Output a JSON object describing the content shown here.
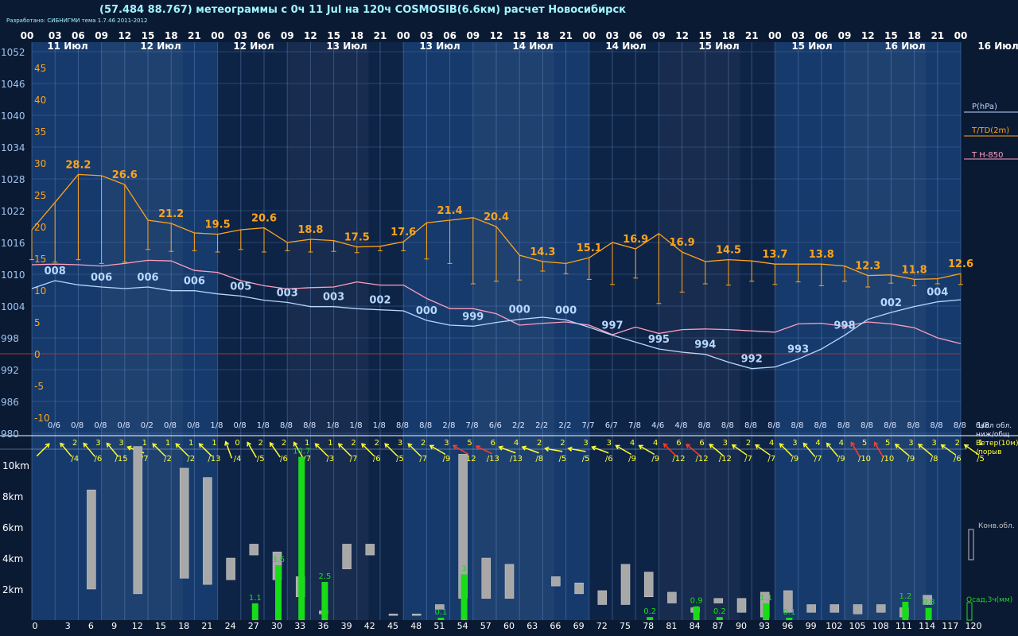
{
  "header": {
    "title": "(57.484 88.767) метеограммы с  0ч 11 Jul на 120ч COSMOSIB(6.6км) расчет Новосибирск",
    "developer": "Разработано: СИБНИГМИ тема 1.7.46 2011-2012"
  },
  "colors": {
    "background": "#0b1a33",
    "band_light": "#163a6b",
    "band_dark": "#0e2447",
    "pressure": "#b8d8ff",
    "temperature": "#ffa41b",
    "t850": "#ff9fc0",
    "zero_line": "#b03030",
    "wind_arrow": "#ffff33",
    "wind_arrow_strong": "#ff3b2b",
    "precip": "#18dc18",
    "cloud": "#a8a8a8",
    "text_time": "#ffffff",
    "pressure_axis": "#9fc4f0"
  },
  "chart_data": {
    "type": "line",
    "time_hours": [
      "00",
      "03",
      "06",
      "09",
      "12",
      "15",
      "18",
      "21",
      "00",
      "03",
      "06",
      "09",
      "12",
      "15",
      "18",
      "21",
      "00",
      "03",
      "06",
      "09",
      "12",
      "15",
      "18",
      "21",
      "00",
      "03",
      "06",
      "09",
      "12",
      "15",
      "18",
      "21",
      "00",
      "03",
      "06",
      "09",
      "12",
      "15",
      "18",
      "21",
      "00"
    ],
    "date_labels": [
      "11 Июл",
      "12 Июл",
      "12 Июл",
      "13 Июл",
      "13 Июл",
      "14 Июл",
      "14 Июл",
      "15 Июл",
      "15 Июл",
      "16 Июл",
      "16 Июл"
    ],
    "forecast_steps": [
      "0",
      "3",
      "6",
      "9",
      "12",
      "15",
      "18",
      "21",
      "24",
      "27",
      "30",
      "33",
      "36",
      "39",
      "42",
      "45",
      "48",
      "51",
      "54",
      "57",
      "60",
      "63",
      "66",
      "69",
      "72",
      "75",
      "78",
      "81",
      "84",
      "87",
      "90",
      "93",
      "96",
      "99",
      "102",
      "105",
      "108",
      "111",
      "114",
      "117",
      "120"
    ],
    "pressure_axis": {
      "label": "P(hPa)",
      "ticks": [
        "1052",
        "1046",
        "1040",
        "1034",
        "1028",
        "1022",
        "1016",
        "1010",
        "1004",
        "998",
        "992",
        "986",
        "980"
      ],
      "range": [
        980,
        1052
      ]
    },
    "temp_axis": {
      "label": "T/TD(2m)",
      "ticks": [
        "45",
        "40",
        "35",
        "30",
        "25",
        "20",
        "15",
        "10",
        "5",
        "0",
        "-5",
        "-10"
      ],
      "range": [
        -10,
        45
      ]
    },
    "t850_label": "T H-850",
    "temperature": [
      19.5,
      23.8,
      28.2,
      28.0,
      26.6,
      21.0,
      20.5,
      19.0,
      18.8,
      19.5,
      19.8,
      17.5,
      18.0,
      17.8,
      16.8,
      16.9,
      17.6,
      20.6,
      21.0,
      21.4,
      20.0,
      15.5,
      14.5,
      14.2,
      15.1,
      17.5,
      16.5,
      18.9,
      16.0,
      14.5,
      14.8,
      14.6,
      14.1,
      14.1,
      14.1,
      13.8,
      12.3,
      12.4,
      11.7,
      11.8,
      12.6
    ],
    "dewpoint": [
      14.8,
      14.4,
      14.8,
      14.2,
      14.4,
      16.4,
      16.1,
      16.2,
      16.0,
      16.4,
      16.0,
      16.2,
      16.0,
      16.1,
      15.9,
      16.2,
      16.2,
      14.9,
      14.2,
      11.0,
      11.4,
      11.6,
      13.0,
      12.6,
      11.7,
      10.9,
      11.9,
      7.9,
      9.7,
      11.0,
      10.8,
      11.4,
      10.9,
      11.3,
      10.7,
      11.4,
      10.5,
      11.1,
      10.7,
      11.0,
      10.9
    ],
    "temperature_labels": [
      {
        "i": 2,
        "v": "28.2"
      },
      {
        "i": 4,
        "v": "26.6"
      },
      {
        "i": 6,
        "v": "21.2"
      },
      {
        "i": 8,
        "v": "19.5"
      },
      {
        "i": 10,
        "v": "20.6"
      },
      {
        "i": 12,
        "v": "18.8"
      },
      {
        "i": 14,
        "v": "17.5"
      },
      {
        "i": 16,
        "v": "17.6"
      },
      {
        "i": 18,
        "v": "21.4"
      },
      {
        "i": 20,
        "v": "20.4"
      },
      {
        "i": 22,
        "v": "14.3"
      },
      {
        "i": 24,
        "v": "15.1"
      },
      {
        "i": 26,
        "v": "16.9"
      },
      {
        "i": 28,
        "v": "16.9"
      },
      {
        "i": 30,
        "v": "14.5"
      },
      {
        "i": 32,
        "v": "13.7"
      },
      {
        "i": 34,
        "v": "13.8"
      },
      {
        "i": 36,
        "v": "12.3"
      },
      {
        "i": 38,
        "v": "11.8"
      },
      {
        "i": 40,
        "v": "12.6"
      }
    ],
    "pressure": [
      1007.3,
      1008.8,
      1008.0,
      1007.6,
      1007.3,
      1007.6,
      1006.9,
      1006.9,
      1006.3,
      1005.9,
      1005.1,
      1004.7,
      1003.9,
      1003.9,
      1003.5,
      1003.3,
      1003.1,
      1001.3,
      1000.4,
      1000.2,
      1000.9,
      1001.5,
      1001.9,
      1001.4,
      1000.0,
      998.5,
      997.2,
      995.9,
      995.3,
      994.9,
      993.4,
      992.2,
      992.5,
      994.0,
      995.9,
      998.5,
      1001.5,
      1002.8,
      1003.9,
      1004.8,
      1005.2
    ],
    "pressure_labels": [
      {
        "i": 1,
        "v": "008"
      },
      {
        "i": 3,
        "v": "006"
      },
      {
        "i": 5,
        "v": "006"
      },
      {
        "i": 7,
        "v": "006"
      },
      {
        "i": 9,
        "v": "005"
      },
      {
        "i": 11,
        "v": "003"
      },
      {
        "i": 13,
        "v": "003"
      },
      {
        "i": 15,
        "v": "002"
      },
      {
        "i": 17,
        "v": "000"
      },
      {
        "i": 19,
        "v": "999"
      },
      {
        "i": 21,
        "v": "000"
      },
      {
        "i": 23,
        "v": "000"
      },
      {
        "i": 25,
        "v": "997"
      },
      {
        "i": 27,
        "v": "995"
      },
      {
        "i": 29,
        "v": "994"
      },
      {
        "i": 31,
        "v": "992"
      },
      {
        "i": 33,
        "v": "993"
      },
      {
        "i": 35,
        "v": "998"
      },
      {
        "i": 37,
        "v": "002"
      },
      {
        "i": 39,
        "v": "004"
      }
    ],
    "t850": [
      14.0,
      14.1,
      14.0,
      13.8,
      14.2,
      14.7,
      14.6,
      13.1,
      12.8,
      11.5,
      10.7,
      10.2,
      10.4,
      10.5,
      11.3,
      10.8,
      10.8,
      8.7,
      7.1,
      7.1,
      6.3,
      4.5,
      4.8,
      5.0,
      4.5,
      3.0,
      4.2,
      3.2,
      3.8,
      3.9,
      3.8,
      3.6,
      3.4,
      4.7,
      4.8,
      4.3,
      5.0,
      4.7,
      4.1,
      2.5,
      1.6
    ],
    "cloud_cover": [
      "0/6",
      "0/8",
      "0/8",
      "0/8",
      "0/2",
      "0/8",
      "0/8",
      "1/8",
      "0/8",
      "1/8",
      "8/8",
      "8/8",
      "1/8",
      "1/8",
      "1/8",
      "8/8",
      "8/8",
      "2/8",
      "7/8",
      "6/6",
      "2/2",
      "2/2",
      "2/2",
      "7/7",
      "6/7",
      "7/8",
      "4/6",
      "4/8",
      "8/8",
      "8/8",
      "8/8",
      "8/8",
      "8/8",
      "8/8",
      "8/8",
      "8/8",
      "8/8",
      "8/8",
      "8/8",
      "8/8",
      "1/8"
    ],
    "cloud_label": "балл обл.\nниж/общ",
    "wind_speed": [
      "",
      "2",
      "3",
      "3",
      "1",
      "1",
      "1",
      "1",
      "0",
      "2",
      "2",
      "1",
      "1",
      "2",
      "2",
      "3",
      "2",
      "3",
      "5",
      "6",
      "4",
      "2",
      "2",
      "3",
      "3",
      "4",
      "4",
      "6",
      "6",
      "3",
      "2",
      "4",
      "3",
      "4",
      "4",
      "5",
      "5",
      "3",
      "3",
      "2",
      "1"
    ],
    "wind_gust": [
      "",
      "/4",
      "/6",
      "/15",
      "/7",
      "/2",
      "/2",
      "/13",
      "/4",
      "/5",
      "/6",
      "/7",
      "/3",
      "/7",
      "/6",
      "/5",
      "/7",
      "/9",
      "/12",
      "/13",
      "/13",
      "/8",
      "/5",
      "/5",
      "/6",
      "/9",
      "/9",
      "/12",
      "/12",
      "/12",
      "/7",
      "/7",
      "/9",
      "/7",
      "/9",
      "/10",
      "/10",
      "/9",
      "/8",
      "/6",
      "/5"
    ],
    "wind_dir": [
      315,
      230,
      230,
      230,
      200,
      225,
      225,
      225,
      250,
      240,
      235,
      240,
      225,
      225,
      225,
      225,
      225,
      210,
      210,
      205,
      200,
      200,
      190,
      190,
      200,
      210,
      210,
      225,
      220,
      220,
      215,
      215,
      225,
      230,
      230,
      240,
      240,
      220,
      220,
      215,
      215
    ],
    "wind_label": "Ветер(10м)\n/порыв",
    "cloud_km_axis": [
      "10km",
      "8km",
      "6km",
      "4km",
      "2km"
    ],
    "cloud_bars": [
      {
        "i": 2,
        "b": 2.0,
        "t": 8.4
      },
      {
        "i": 4,
        "b": 1.7,
        "t": 11.2
      },
      {
        "i": 6,
        "b": 2.7,
        "t": 9.8
      },
      {
        "i": 7,
        "b": 2.3,
        "t": 9.2
      },
      {
        "i": 8,
        "b": 2.6,
        "t": 4.0
      },
      {
        "i": 9,
        "b": 4.2,
        "t": 4.9
      },
      {
        "i": 10,
        "b": 2.6,
        "t": 4.4
      },
      {
        "i": 11,
        "b": 1.5,
        "t": 2.8
      },
      {
        "i": 12,
        "b": 0.4,
        "t": 0.6
      },
      {
        "i": 13,
        "b": 3.3,
        "t": 4.9
      },
      {
        "i": 14,
        "b": 4.2,
        "t": 4.9
      },
      {
        "i": 15,
        "b": 0.3,
        "t": 0.4
      },
      {
        "i": 16,
        "b": 0.3,
        "t": 0.4
      },
      {
        "i": 17,
        "b": 0.7,
        "t": 1.0
      },
      {
        "i": 18,
        "b": 1.4,
        "t": 10.7
      },
      {
        "i": 19,
        "b": 1.4,
        "t": 4.0
      },
      {
        "i": 20,
        "b": 1.4,
        "t": 3.6
      },
      {
        "i": 22,
        "b": 2.2,
        "t": 2.8
      },
      {
        "i": 23,
        "b": 1.7,
        "t": 2.4
      },
      {
        "i": 24,
        "b": 1.0,
        "t": 1.9
      },
      {
        "i": 25,
        "b": 1.0,
        "t": 3.6
      },
      {
        "i": 26,
        "b": 1.5,
        "t": 3.1
      },
      {
        "i": 27,
        "b": 1.1,
        "t": 1.8
      },
      {
        "i": 28,
        "b": 0.5,
        "t": 0.8
      },
      {
        "i": 29,
        "b": 1.1,
        "t": 1.4
      },
      {
        "i": 30,
        "b": 0.5,
        "t": 1.4
      },
      {
        "i": 31,
        "b": 0.2,
        "t": 1.8
      },
      {
        "i": 32,
        "b": 0.5,
        "t": 1.9
      },
      {
        "i": 33,
        "b": 0.5,
        "t": 1.0
      },
      {
        "i": 34,
        "b": 0.5,
        "t": 1.0
      },
      {
        "i": 35,
        "b": 0.4,
        "t": 1.0
      },
      {
        "i": 36,
        "b": 0.5,
        "t": 1.0
      },
      {
        "i": 37,
        "b": 0.2,
        "t": 0.8
      },
      {
        "i": 38,
        "b": 1.0,
        "t": 1.6
      }
    ],
    "precip": [
      {
        "i": 9,
        "v": 1.1
      },
      {
        "i": 10,
        "v": 3.6
      },
      {
        "i": 11,
        "v": 10.7
      },
      {
        "i": 12,
        "v": 2.5
      },
      {
        "i": 17,
        "v": 0.1
      },
      {
        "i": 18,
        "v": 3
      },
      {
        "i": 26,
        "v": 0.2
      },
      {
        "i": 28,
        "v": 0.9
      },
      {
        "i": 29,
        "v": 0.2
      },
      {
        "i": 31,
        "v": 1.1
      },
      {
        "i": 32,
        "v": 0.1
      },
      {
        "i": 37,
        "v": 1.2
      },
      {
        "i": 38,
        "v": 0.8
      }
    ],
    "precip_label_text": [
      "1.1",
      "3.6",
      "10.7",
      "2.5",
      "0.1",
      "3",
      "0.2",
      "0.9",
      "0.2",
      "1.1",
      "0.1",
      "1.2",
      "0.8"
    ],
    "conv_label": "Конв.обл.",
    "precip_legend": "Осад,3ч(мм)"
  }
}
